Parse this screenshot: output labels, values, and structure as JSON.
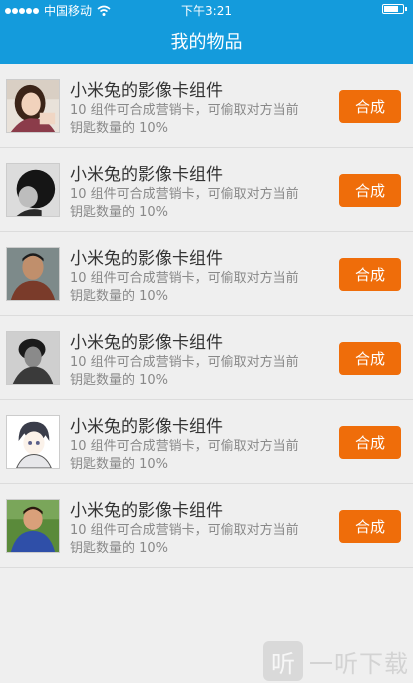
{
  "status_bar": {
    "carrier": "中国移动",
    "time": "下午3:21",
    "signal_icon": "signal-dots-icon",
    "wifi_icon": "wifi-icon",
    "battery_icon": "battery-icon"
  },
  "header": {
    "title": "我的物品"
  },
  "items": [
    {
      "title": "小米兔的影像卡组件",
      "desc": "10 组件可合成营销卡，可偷取对方当前钥匙数量的 10%",
      "action": "合成",
      "avatar": "woman-portrait-avatar"
    },
    {
      "title": "小米兔的影像卡组件",
      "desc": "10 组件可合成营销卡，可偷取对方当前钥匙数量的 10%",
      "action": "合成",
      "avatar": "short-hair-profile-avatar"
    },
    {
      "title": "小米兔的影像卡组件",
      "desc": "10 组件可合成营销卡，可偷取对方当前钥匙数量的 10%",
      "action": "合成",
      "avatar": "man-portrait-avatar"
    },
    {
      "title": "小米兔的影像卡组件",
      "desc": "10 组件可合成营销卡，可偷取对方当前钥匙数量的 10%",
      "action": "合成",
      "avatar": "man-grayscale-avatar"
    },
    {
      "title": "小米兔的影像卡组件",
      "desc": "10 组件可合成营销卡，可偷取对方当前钥匙数量的 10%",
      "action": "合成",
      "avatar": "anime-boy-avatar"
    },
    {
      "title": "小米兔的影像卡组件",
      "desc": "10 组件可合成营销卡，可偷取对方当前钥匙数量的 10%",
      "action": "合成",
      "avatar": "boy-outdoor-avatar"
    }
  ],
  "watermark": {
    "text": "一听下载",
    "icon_glyph": "听"
  },
  "colors": {
    "header": "#149bdc",
    "button": "#ef6d0a",
    "background": "#efefef"
  }
}
